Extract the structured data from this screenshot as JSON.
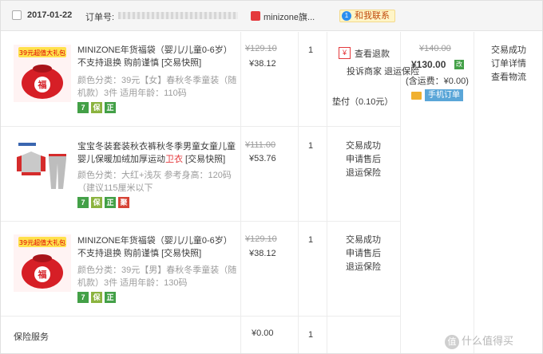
{
  "header": {
    "date": "2017-01-22",
    "order_label": "订单号:",
    "shop_icon": "天猫",
    "shop_name": "minizone旗...",
    "chat_icon": "1",
    "chat_label": "和我联系"
  },
  "items": [
    {
      "thumb_label": "39元超值大礼包",
      "name_a": "MINIZONE年货福袋（婴儿/儿童0-6岁）不支持退换 购前谨慎 [交易快照]",
      "name_hl": "",
      "name_b": "",
      "sku": "颜色分类：39元【女】春秋冬季童装（随机款）3件  适用年龄：110码",
      "badges": [
        "7",
        "保",
        "正"
      ],
      "orig_price": "¥129.10",
      "price": "¥38.12",
      "qty": "1"
    },
    {
      "thumb_label": "",
      "name_a": "宝宝冬装套装秋衣裤秋冬季男童女童儿童婴儿保暖加绒加厚运动",
      "name_hl": "卫衣",
      "name_b": " [交易快照]",
      "sku": "颜色分类：大红+浅灰   参考身高：120码（建议115厘米以下",
      "badges": [
        "7",
        "保",
        "正",
        "聚"
      ],
      "orig_price": "¥111.00",
      "price": "¥53.76",
      "qty": "1"
    },
    {
      "thumb_label": "39元超值大礼包",
      "name_a": "MINIZONE年货福袋（婴儿/儿童0-6岁）不支持退换 购前谨慎 [交易快照]",
      "name_hl": "",
      "name_b": "",
      "sku": "颜色分类：39元【男】春秋冬季童装（随机款）3件  适用年龄：130码",
      "badges": [
        "7",
        "保",
        "正"
      ],
      "orig_price": "¥129.10",
      "price": "¥38.12",
      "qty": "1"
    }
  ],
  "service": {
    "refund_icon": "¥",
    "refund_label": "查看退款",
    "item1_links": [
      "投诉商家",
      "退运保险"
    ],
    "item1_pad": "垫付（0.10元）",
    "item2_links": [
      "交易成功",
      "申请售后",
      "退运保险"
    ],
    "item3_links": [
      "交易成功",
      "申请售后",
      "退运保险"
    ]
  },
  "totals": {
    "orig": "¥140.00",
    "total": "¥130.00",
    "total_tag": "改",
    "shipping": "(含运费：¥0.00)",
    "mobile_order": "手机订单"
  },
  "status": {
    "links": [
      "交易成功",
      "订单详情",
      "查看物流"
    ]
  },
  "insurance": {
    "label": "保险服务",
    "price": "¥0.00",
    "qty": "1"
  },
  "watermark": {
    "logo": "值",
    "text": "什么值得买"
  },
  "colors": {
    "accent_red": "#e4393c",
    "badge_green": "#43a047",
    "header_bg": "#f5f5f5"
  }
}
